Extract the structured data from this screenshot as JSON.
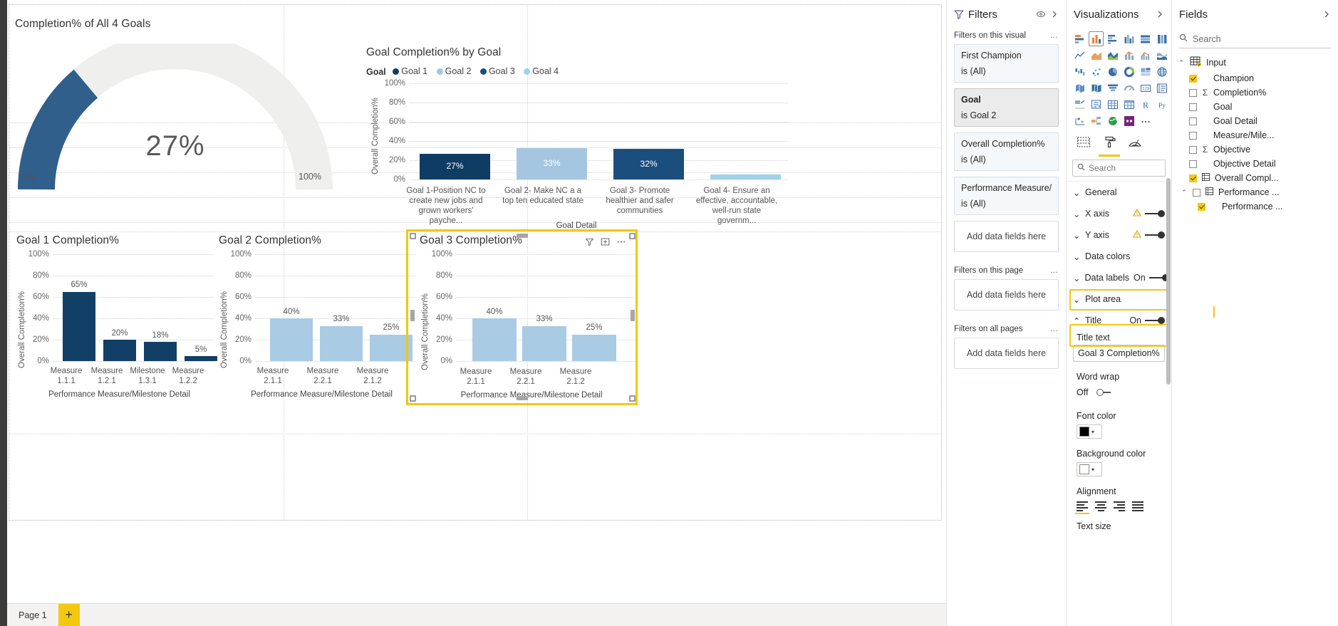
{
  "canvas": {
    "page_tab": "Page 1",
    "add_page_label": "+"
  },
  "visuals": {
    "gauge": {
      "title": "Completion% of All 4 Goals",
      "value_label": "27%",
      "min_label": "0%",
      "max_label": "100%",
      "value": 27,
      "fill_color": "#2f5f8a",
      "track_color": "#efefed"
    },
    "goal_by_goal": {
      "title": "Goal Completion% by Goal",
      "legend_title": "Goal",
      "ylabel": "Overall Completion%",
      "xlabel": "Goal Detail"
    },
    "goal1": {
      "title": "Goal 1 Completion%",
      "ylabel": "Overall Completion%",
      "xlabel": "Performance Measure/Milestone Detail"
    },
    "goal2": {
      "title": "Goal 2 Completion%",
      "ylabel": "Overall Completion%",
      "xlabel": "Performance Measure/Milestone Detail"
    },
    "goal3": {
      "title": "Goal 3 Completion%",
      "ylabel": "Overall Completion%",
      "xlabel": "Performance Measure/Milestone Detail"
    }
  },
  "chart_data": [
    {
      "type": "bar",
      "name": "goal-completion-by-goal",
      "title": "Goal Completion% by Goal",
      "xlabel": "Goal Detail",
      "ylabel": "Overall Completion%",
      "ylim": [
        0,
        100
      ],
      "yticks": [
        "0%",
        "20%",
        "40%",
        "60%",
        "80%",
        "100%"
      ],
      "grid": true,
      "legend_position": "top",
      "legend_title": "Goal",
      "legend": [
        {
          "name": "Goal 1",
          "color": "#0e3c62"
        },
        {
          "name": "Goal 2",
          "color": "#a5c6e0"
        },
        {
          "name": "Goal 3",
          "color": "#1b4e7d"
        },
        {
          "name": "Goal 4",
          "color": "#9fd2e8"
        }
      ],
      "categories": [
        "Goal 1-Position NC to create new jobs and grown workers' payche...",
        "Goal 2- Make NC a a top ten educated state",
        "Goal 3- Promote healthier and safer communities",
        "Goal 4- Ensure an effective, accountable, well-run state governm..."
      ],
      "values": [
        27,
        33,
        32,
        5
      ],
      "data_labels": [
        "27%",
        "33%",
        "32%",
        ""
      ],
      "colors": [
        "#0e3c62",
        "#a5c6e0",
        "#1b4e7d",
        "#9fd2e8"
      ]
    },
    {
      "type": "bar",
      "name": "goal-1-completion",
      "title": "Goal 1 Completion%",
      "xlabel": "Performance Measure/Milestone Detail",
      "ylabel": "Overall Completion%",
      "ylim": [
        0,
        100
      ],
      "yticks": [
        "0%",
        "20%",
        "40%",
        "60%",
        "80%",
        "100%"
      ],
      "grid": true,
      "categories": [
        "Measure 1.1.1",
        "Measure 1.2.1",
        "Milestone 1.3.1",
        "Measure 1.2.2"
      ],
      "values": [
        65,
        20,
        18,
        5
      ],
      "data_labels": [
        "65%",
        "20%",
        "18%",
        "5%"
      ],
      "color": "#123f66"
    },
    {
      "type": "bar",
      "name": "goal-2-completion",
      "title": "Goal 2 Completion%",
      "xlabel": "Performance Measure/Milestone Detail",
      "ylabel": "Overall Completion%",
      "ylim": [
        0,
        100
      ],
      "yticks": [
        "0%",
        "20%",
        "40%",
        "60%",
        "80%",
        "100%"
      ],
      "grid": true,
      "categories": [
        "Measure 2.1.1",
        "Measure 2.2.1",
        "Measure 2.1.2"
      ],
      "values": [
        40,
        33,
        25
      ],
      "data_labels": [
        "40%",
        "33%",
        "25%"
      ],
      "color": "#a9cbe4"
    },
    {
      "type": "bar",
      "name": "goal-3-completion",
      "title": "Goal 3 Completion%",
      "xlabel": "Performance Measure/Milestone Detail",
      "ylabel": "Overall Completion%",
      "ylim": [
        0,
        100
      ],
      "yticks": [
        "0%",
        "20%",
        "40%",
        "60%",
        "80%",
        "100%"
      ],
      "grid": true,
      "categories": [
        "Measure 2.1.1",
        "Measure 2.2.1",
        "Measure 2.1.2"
      ],
      "values": [
        40,
        33,
        25
      ],
      "data_labels": [
        "40%",
        "33%",
        "25%"
      ],
      "color": "#a9cbe4"
    }
  ],
  "filters_pane": {
    "title": "Filters",
    "sections": [
      {
        "label": "Filters on this visual",
        "menu": "…"
      },
      {
        "label": "Filters on this page",
        "menu": "…"
      },
      {
        "label": "Filters on all pages",
        "menu": "…"
      }
    ],
    "visual_filters": [
      {
        "field": "First Champion",
        "value": "is (All)",
        "active": false
      },
      {
        "field": "Goal",
        "value": "is Goal 2",
        "active": true
      },
      {
        "field": "Overall Completion%",
        "value": "is (All)",
        "active": false
      },
      {
        "field": "Performance Measure/M",
        "value": "is (All)",
        "active": false
      }
    ],
    "drop_label": "Add data fields here"
  },
  "viz_pane": {
    "title": "Visualizations",
    "search_placeholder": "Search",
    "tabs": [
      "fields-tab",
      "format-tab",
      "analytics-tab"
    ],
    "active_tab": "format-tab",
    "format_rows": [
      {
        "label": "General",
        "chevron": "⌄",
        "type": "section"
      },
      {
        "label": "X axis",
        "chevron": "⌄",
        "type": "section",
        "warn": true,
        "toggle": "on"
      },
      {
        "label": "Y axis",
        "chevron": "⌄",
        "type": "section",
        "warn": true,
        "toggle": "on"
      },
      {
        "label": "Data colors",
        "chevron": "⌄",
        "type": "section"
      },
      {
        "label": "Data labels",
        "chevron": "⌄",
        "type": "section",
        "state": "On",
        "toggle": "on"
      },
      {
        "label": "Plot area",
        "chevron": "⌄",
        "type": "section"
      },
      {
        "label": "Title",
        "chevron": "⌃",
        "type": "section",
        "state": "On",
        "toggle": "on",
        "highlighted": true
      }
    ],
    "title_text_label": "Title text",
    "title_text_value": "Goal 3 Completion%",
    "word_wrap_label": "Word wrap",
    "word_wrap_state": "Off",
    "font_color_label": "Font color",
    "font_color_value": "#000000",
    "background_color_label": "Background color",
    "background_color_value": "#ffffff",
    "alignment_label": "Alignment",
    "text_size_label": "Text size"
  },
  "fields_pane": {
    "title": "Fields",
    "search_placeholder": "Search",
    "table": "Input",
    "fields": [
      {
        "label": "Champion",
        "checked": true,
        "measure": false
      },
      {
        "label": "Completion%",
        "checked": false,
        "measure": true
      },
      {
        "label": "Goal",
        "checked": false,
        "measure": false
      },
      {
        "label": "Goal Detail",
        "checked": false,
        "measure": false
      },
      {
        "label": "Measure/Mile...",
        "checked": false,
        "measure": false
      },
      {
        "label": "Objective",
        "checked": false,
        "measure": true
      },
      {
        "label": "Objective Detail",
        "checked": false,
        "measure": false
      },
      {
        "label": "Overall Compl...",
        "checked": true,
        "measure": false,
        "calc": true
      },
      {
        "label": "Performance ...",
        "checked": false,
        "measure": false,
        "group": true
      },
      {
        "label": "Performance ...",
        "checked": true,
        "measure": false,
        "child": true
      }
    ]
  },
  "colors": {
    "accent": "#f2c811",
    "dark_blue": "#0e3c62",
    "mid_blue": "#1b4e7d",
    "light_blue": "#a5c6e0",
    "pale_blue": "#9fd2e8"
  }
}
